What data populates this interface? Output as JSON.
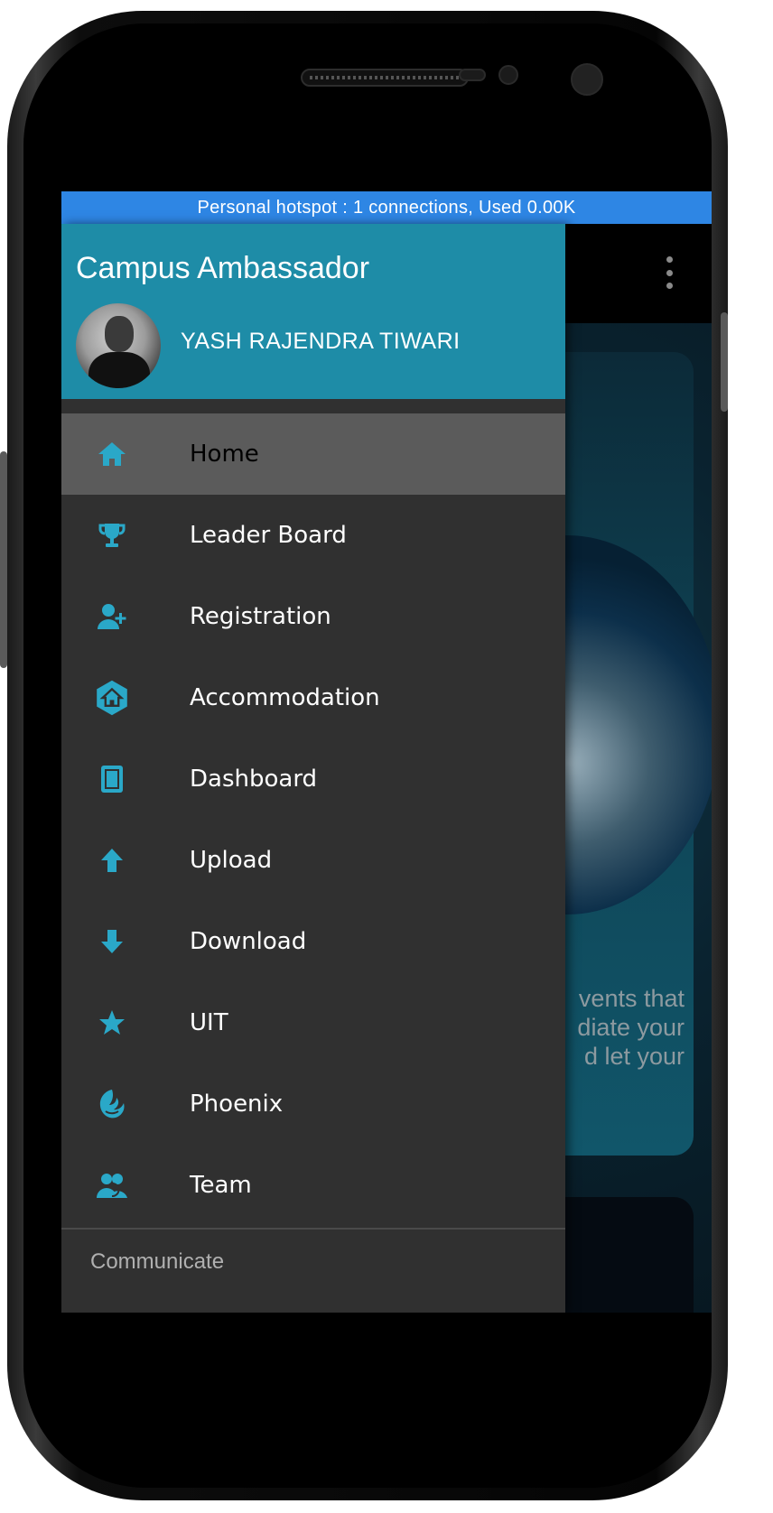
{
  "status_bar": {
    "text": "Personal hotspot : 1 connections, Used 0.00K"
  },
  "drawer": {
    "app_title": "Campus Ambassador",
    "user_name": "YASH RAJENDRA TIWARI",
    "items": [
      {
        "label": "Home",
        "icon": "home-icon",
        "active": true
      },
      {
        "label": "Leader Board",
        "icon": "trophy-icon"
      },
      {
        "label": "Registration",
        "icon": "add-user-icon"
      },
      {
        "label": "Accommodation",
        "icon": "house-hexagon-icon"
      },
      {
        "label": "Dashboard",
        "icon": "tablet-icon"
      },
      {
        "label": "Upload",
        "icon": "arrow-up-icon"
      },
      {
        "label": "Download",
        "icon": "arrow-down-icon"
      },
      {
        "label": "UIT",
        "icon": "star-icon"
      },
      {
        "label": "Phoenix",
        "icon": "phoenix-icon"
      },
      {
        "label": "Team",
        "icon": "team-icon"
      }
    ],
    "section_label": "Communicate"
  },
  "background": {
    "peek_lines": [
      "vents that",
      "diate your",
      "d let your"
    ]
  },
  "colors": {
    "accent": "#1e8ca7",
    "icon": "#2aa8c8",
    "status_bar": "#2e86e4",
    "drawer_bg": "#303030",
    "active_bg": "#5b5b5b"
  }
}
